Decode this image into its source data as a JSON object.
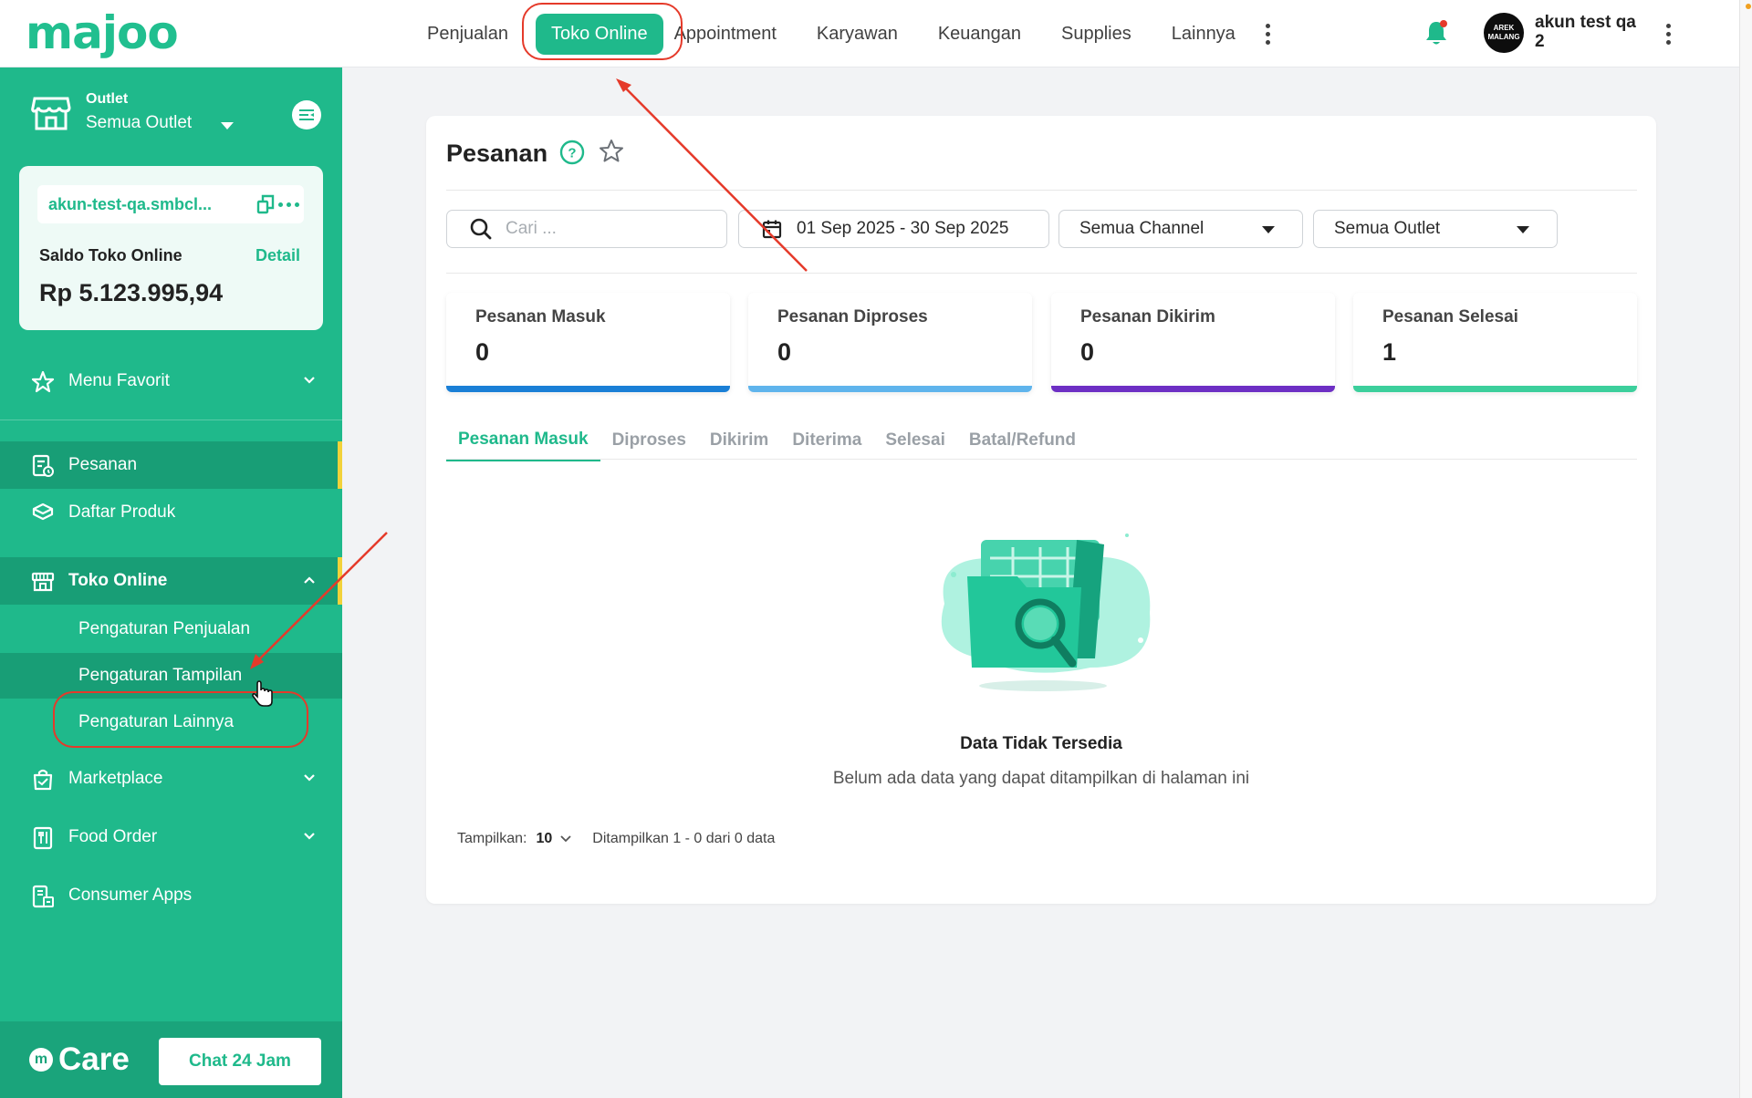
{
  "brand": {
    "logo_text": "majoo"
  },
  "topnav": {
    "items": [
      "Penjualan",
      "Toko Online",
      "Appointment",
      "Karyawan",
      "Keuangan",
      "Supplies",
      "Lainnya"
    ],
    "active": "Toko Online"
  },
  "user": {
    "avatar_line1": "AREK",
    "avatar_line2": "MALANG",
    "name": "akun test qa 2"
  },
  "sidebar": {
    "outlet_label": "Outlet",
    "outlet_value": "Semua Outlet",
    "store_url": "akun-test-qa.smbcl...",
    "saldo_label": "Saldo Toko Online",
    "detail_label": "Detail",
    "saldo_amount": "Rp 5.123.995,94",
    "menu_favorit": "Menu Favorit",
    "items": [
      {
        "label": "Pesanan"
      },
      {
        "label": "Daftar Produk"
      },
      {
        "label": "Toko Online"
      },
      {
        "label": "Marketplace"
      },
      {
        "label": "Food Order"
      },
      {
        "label": "Consumer Apps"
      }
    ],
    "sub_items": [
      "Pengaturan Penjualan",
      "Pengaturan Tampilan",
      "Pengaturan Lainnya"
    ],
    "care_text": "Care",
    "care_m": "m",
    "chat_button": "Chat 24 Jam"
  },
  "main": {
    "title": "Pesanan",
    "search_placeholder": "Cari ...",
    "date_range": "01 Sep 2025 - 30 Sep 2025",
    "channel_select": "Semua Channel",
    "outlet_select": "Semua Outlet",
    "stats": [
      {
        "label": "Pesanan Masuk",
        "value": "0",
        "color": "#1a7fd6"
      },
      {
        "label": "Pesanan Diproses",
        "value": "0",
        "color": "#5fb4ec"
      },
      {
        "label": "Pesanan Dikirim",
        "value": "0",
        "color": "#6d2fc4"
      },
      {
        "label": "Pesanan Selesai",
        "value": "1",
        "color": "#3ccf9c"
      }
    ],
    "tabs": [
      "Pesanan Masuk",
      "Diproses",
      "Dikirim",
      "Diterima",
      "Selesai",
      "Batal/Refund"
    ],
    "empty_title": "Data Tidak Tersedia",
    "empty_subtitle": "Belum ada data yang dapat ditampilkan di halaman ini",
    "pager_label": "Tampilkan:",
    "pager_value": "10",
    "pager_info": "Ditampilkan 1 - 0 dari 0 data"
  },
  "colors": {
    "primary": "#1fb98b",
    "annotation": "#e53a2a",
    "highlight": "#f2d23a"
  }
}
